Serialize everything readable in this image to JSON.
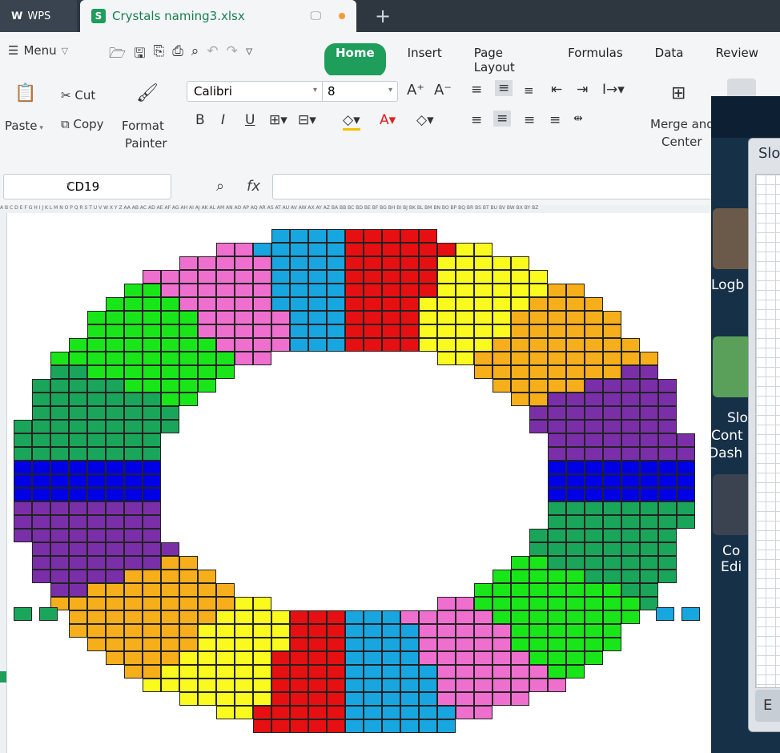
{
  "titlebar": {
    "app_name": "WPS",
    "file_name": "Crystals naming3.xlsx",
    "new_tab": "+"
  },
  "menubar": {
    "menu_label": "Menu",
    "tabs": [
      "Home",
      "Insert",
      "Page Layout",
      "Formulas",
      "Data",
      "Review"
    ],
    "active_tab": "Home"
  },
  "ribbon": {
    "paste": "Paste",
    "cut": "Cut",
    "copy": "Copy",
    "format_painter_1": "Format",
    "format_painter_2": "Painter",
    "font_name": "Calibri",
    "font_size": "8",
    "merge_1": "Merge and",
    "merge_2": "Center"
  },
  "formula_bar": {
    "cell_ref": "CD19",
    "fx": "fx",
    "content": ""
  },
  "column_headers": "A B C D E F G H I J K L M N O P Q R S T U V W X Y Z AA AB AC AD AE AF AG AH AI AJ AK AL AM AN AO AP AQ AR AS AT AU AV AW AX AY AZ BA BB BC BD BE BF BG BH BI BJ BK BL BM BN BO BP BQ BR BS BT BU BV BW BX BY BZ",
  "side_panel": {
    "dialog_title": "Slo",
    "labels": [
      "Logb",
      "Slo",
      "Cont",
      "Dash",
      "Co",
      "Edi"
    ],
    "bottom_button": "E"
  },
  "colors": {
    "green_dark": "#1aa65a",
    "lime": "#19e619",
    "pink": "#ef6fcf",
    "blue_light": "#17a6e0",
    "blue": "#0000e6",
    "red": "#e60f12",
    "yellow": "#fafa1e",
    "orange": "#f6ae1a",
    "purple": "#7a2fa8",
    "accent": "#1f9d5a"
  }
}
